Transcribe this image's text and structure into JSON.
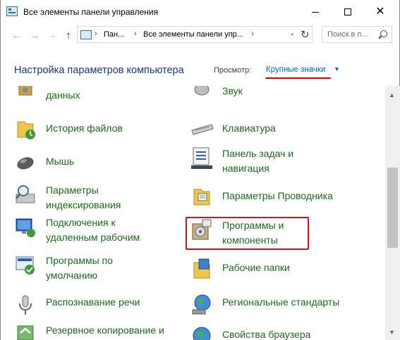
{
  "window": {
    "title": "Все элементы панели управления",
    "min_glyph": "—",
    "max_glyph": "☐",
    "close_glyph": "✕"
  },
  "nav": {
    "back_glyph": "←",
    "forward_glyph": "→",
    "recent_glyph": "⌄",
    "up_glyph": "↑"
  },
  "address": {
    "crumbs": [
      "Пан...",
      "Все элементы панели упр..."
    ],
    "separator": "›",
    "dropdown_glyph": "⌄",
    "refresh_glyph": "↻"
  },
  "search": {
    "placeholder": "Поиск в п..."
  },
  "header": {
    "title": "Настройка параметров компьютера",
    "view_label": "Просмотр:",
    "view_value": "Крупные значки",
    "view_caret": "▼"
  },
  "items_left": [
    {
      "label": "данных",
      "icon": "backup-data-icon"
    },
    {
      "label": "История файлов",
      "icon": "file-history-icon"
    },
    {
      "label": "Мышь",
      "icon": "mouse-icon"
    },
    {
      "label": "Параметры индексирования",
      "icon": "indexing-options-icon"
    },
    {
      "label": "Подключения к удаленным рабочим",
      "icon": "remote-connections-icon"
    },
    {
      "label": "Программы по умолчанию",
      "icon": "default-programs-icon"
    },
    {
      "label": "Распознавание речи",
      "icon": "speech-recognition-icon"
    },
    {
      "label": "Резервное копирование и",
      "icon": "backup-restore-icon"
    }
  ],
  "items_right": [
    {
      "label": "Звук",
      "icon": "sound-icon"
    },
    {
      "label": "Клавиатура",
      "icon": "keyboard-icon"
    },
    {
      "label": "Панель задач и навигация",
      "icon": "taskbar-icon"
    },
    {
      "label": "Параметры Проводника",
      "icon": "explorer-options-icon"
    },
    {
      "label": "Программы и компоненты",
      "icon": "programs-features-icon"
    },
    {
      "label": "Рабочие папки",
      "icon": "work-folders-icon"
    },
    {
      "label": "Региональные стандарты",
      "icon": "region-icon"
    },
    {
      "label": "Свойства браузера",
      "icon": "internet-options-icon"
    }
  ],
  "scrollbar": {
    "up_glyph": "▲",
    "down_glyph": "▼"
  }
}
